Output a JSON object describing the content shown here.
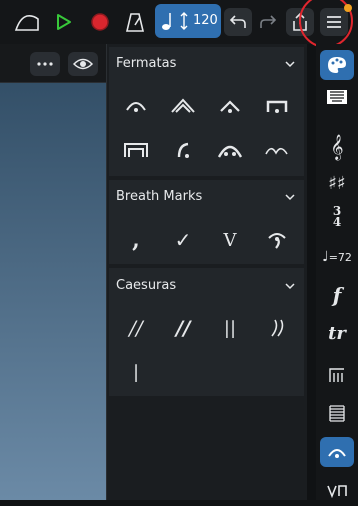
{
  "toolbar": {
    "tempo_value": "120",
    "icons": [
      "curve-icon",
      "play-icon",
      "record-icon",
      "metronome-icon",
      "tempo-note-icon",
      "undo-icon",
      "redo-icon",
      "share-icon",
      "menu-icon"
    ],
    "colors": {
      "play": "#38c83a",
      "record": "#d8262e",
      "tempo_bg": "#2f6fb0",
      "highlight": "#e0262e"
    }
  },
  "score": {
    "icons": [
      "more-icon",
      "eye-icon"
    ]
  },
  "palette": {
    "fermatas": {
      "title": "Fermatas",
      "symbols": [
        "fermata",
        "very-long-fermata",
        "short-fermata",
        "long-fermata",
        "long-henze-fermata",
        "short-henze-fermata",
        "very-long-fermata-dots",
        "very-short-fermata"
      ]
    },
    "breath_marks": {
      "title": "Breath Marks",
      "symbols": [
        ",",
        "✓",
        "V",
        "salzedo-breath"
      ],
      "labels": {
        "comma": ",",
        "tick": "✓",
        "v": "V"
      }
    },
    "caesuras": {
      "title": "Caesuras",
      "symbols": [
        "//",
        "//",
        "||",
        "curved-caesura",
        "|"
      ],
      "labels": {
        "slash": "//",
        "thick": "//",
        "double": "||",
        "single": "|"
      }
    }
  },
  "rightbar": {
    "items": [
      "palette-icon",
      "keyboard-icon",
      "treble-clef-icon",
      "key-signature-icon",
      "time-signature-icon",
      "tempo-icon",
      "dynamics-icon",
      "ornaments-icon",
      "repeats-icon",
      "layout-icon",
      "fermata-icon",
      "articulation-icon"
    ],
    "labels": {
      "time_sig_top": "3",
      "time_sig_bottom": "4",
      "tempo": "=72",
      "dynamics": "f",
      "ornament": "tr"
    },
    "active_color": "#2f6fb0"
  }
}
